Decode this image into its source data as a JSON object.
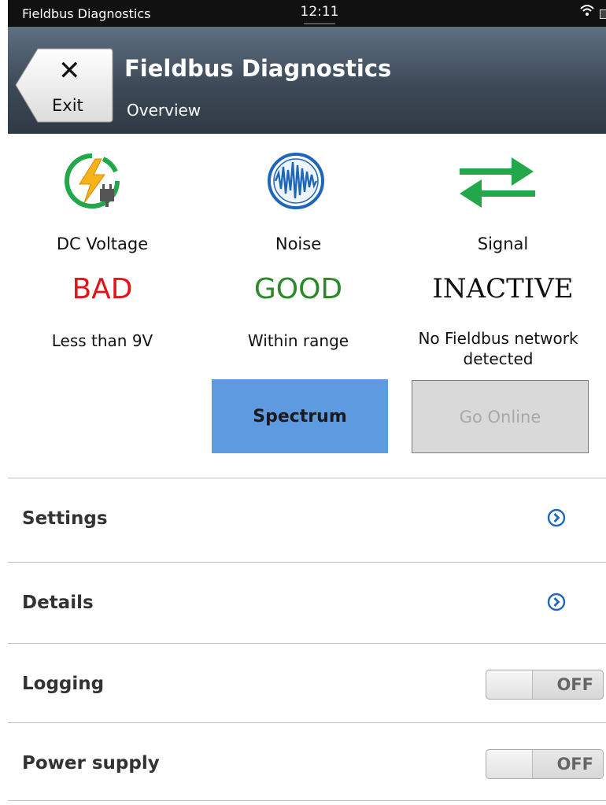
{
  "status_bar": {
    "app_name": "Fieldbus Diagnostics",
    "time": "12:11",
    "wifi_icon": "wifi-icon",
    "battery_icon": "battery-icon"
  },
  "header": {
    "exit_button": {
      "label": "Exit",
      "icon": "close-icon"
    },
    "title": "Fieldbus Diagnostics",
    "subtitle": "Overview",
    "background_color": "#3d4957"
  },
  "diagnostics": [
    {
      "label": "DC Voltage",
      "state": "BAD",
      "state_color": "#e2141a",
      "description": "Less than 9V",
      "icon": "power-plug-bolt-icon"
    },
    {
      "label": "Noise",
      "state": "GOOD",
      "state_color": "#2a8a2a",
      "description": "Within range",
      "icon": "waveform-icon",
      "button": "Spectrum"
    },
    {
      "label": "Signal",
      "state": "INACTIVE",
      "state_color": "#111111",
      "description": "No Fieldbus network detected",
      "icon": "exchange-arrows-icon",
      "button": "Go Online"
    }
  ],
  "menu": {
    "settings": {
      "label": "Settings",
      "icon": "chevron-right-circle-icon"
    },
    "details": {
      "label": "Details",
      "icon": "chevron-right-circle-icon"
    },
    "logging": {
      "label": "Logging",
      "toggle": "OFF"
    },
    "power_supply": {
      "label": "Power supply",
      "toggle": "OFF"
    }
  },
  "colors": {
    "accent_button": "#5d9ae0",
    "disabled_button": "#d9d9d9",
    "icon_green": "#22a84a",
    "icon_blue": "#1e66b8"
  }
}
